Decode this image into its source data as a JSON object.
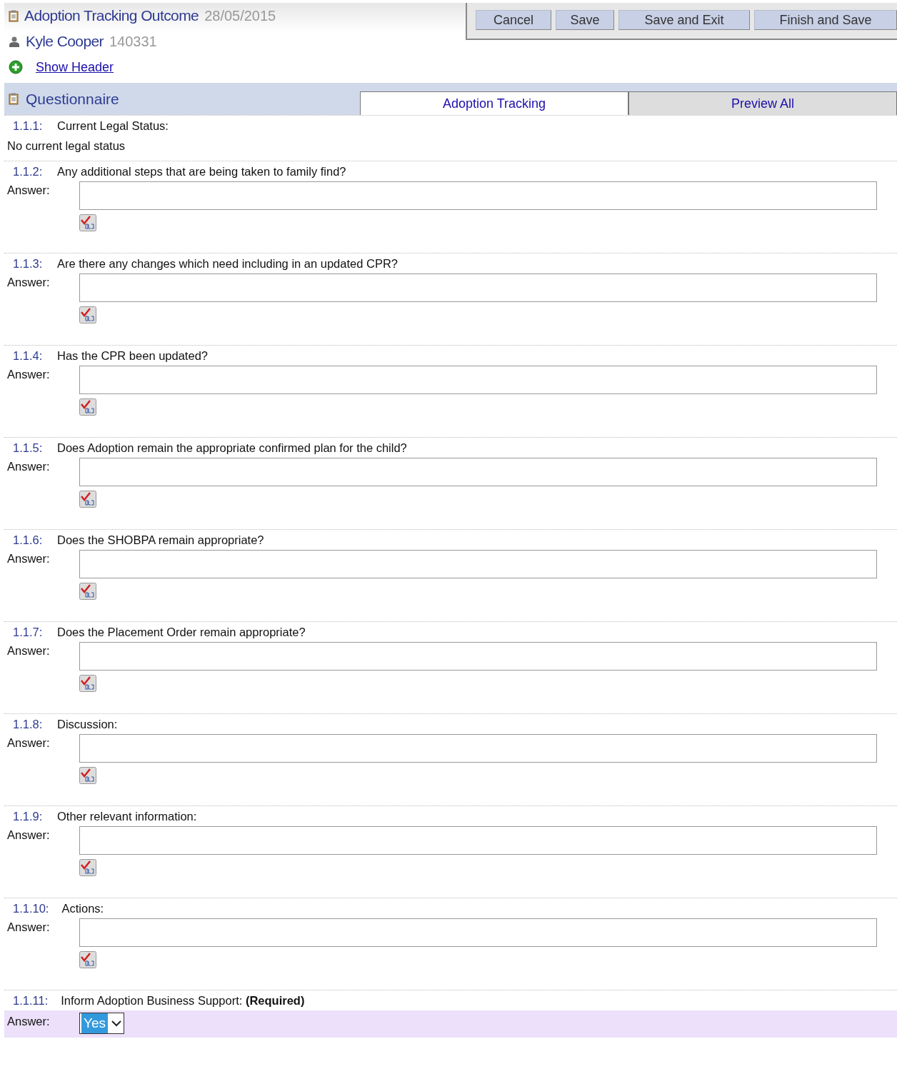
{
  "header": {
    "title": "Adoption Tracking Outcome",
    "date": "28/05/2015",
    "person": "Kyle Cooper",
    "person_id": "140331",
    "show_header": "Show Header"
  },
  "toolbar": [
    "Cancel",
    "Save",
    "Save and Exit",
    "Finish and Save"
  ],
  "section": {
    "title": "Questionnaire"
  },
  "tabs": [
    {
      "label": "Adoption Tracking",
      "selected": true
    },
    {
      "label": "Preview All",
      "selected": false
    }
  ],
  "questions": [
    {
      "kind": "static",
      "number": "1.1.1:",
      "text": "Current Legal Status:",
      "value": "No current legal status"
    },
    {
      "kind": "text",
      "number": "1.1.2:",
      "text": "Any additional steps that are being taken to family find?",
      "answer_label": "Answer:"
    },
    {
      "kind": "text",
      "number": "1.1.3:",
      "text": "Are there any changes which need including in an updated CPR?",
      "answer_label": "Answer:"
    },
    {
      "kind": "text",
      "number": "1.1.4:",
      "text": "Has the CPR been updated?",
      "answer_label": "Answer:"
    },
    {
      "kind": "text",
      "number": "1.1.5:",
      "text": "Does Adoption remain the appropriate confirmed plan for the child?",
      "answer_label": "Answer:"
    },
    {
      "kind": "text",
      "number": "1.1.6:",
      "text": "Does the SHOBPA remain appropriate?",
      "answer_label": "Answer:"
    },
    {
      "kind": "text",
      "number": "1.1.7:",
      "text": "Does the Placement Order remain appropriate?",
      "answer_label": "Answer:"
    },
    {
      "kind": "text",
      "number": "1.1.8:",
      "text": "Discussion:",
      "answer_label": "Answer:"
    },
    {
      "kind": "text",
      "number": "1.1.9:",
      "text": "Other relevant information:",
      "answer_label": "Answer:"
    },
    {
      "kind": "text",
      "number": "1.1.10:",
      "text": "Actions:",
      "answer_label": "Answer:"
    },
    {
      "kind": "select",
      "number": "1.1.11:",
      "text": "Inform Adoption Business Support: **(Required)**",
      "answer_label": "Answer:",
      "value": "Yes"
    }
  ]
}
